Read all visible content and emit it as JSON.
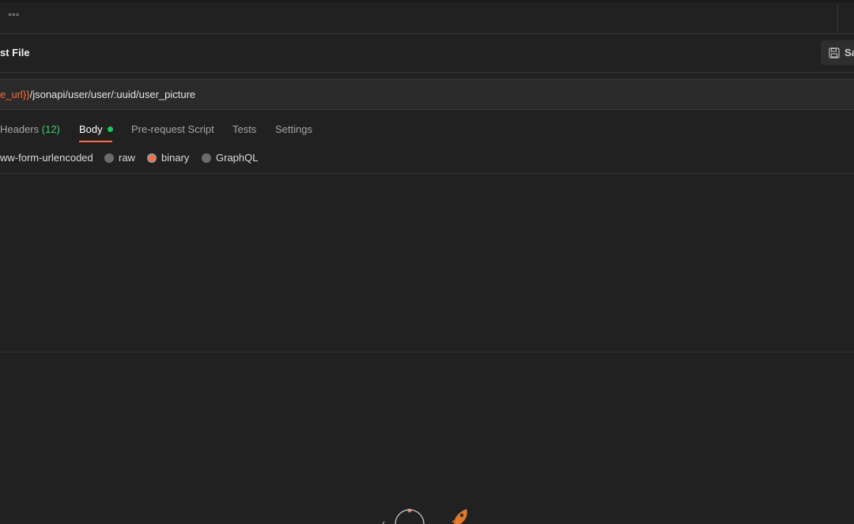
{
  "tabbar": {
    "more_label": "°°°"
  },
  "request": {
    "title": "st File",
    "save_label": "Sa"
  },
  "url": {
    "variable": "e_url}}",
    "path": "/jsonapi/user/user/:uuid/user_picture"
  },
  "request_tabs": [
    {
      "label": "Headers",
      "count": "(12)"
    },
    {
      "label": "Body"
    },
    {
      "label": "Pre-request Script"
    },
    {
      "label": "Tests"
    },
    {
      "label": "Settings"
    }
  ],
  "body_types": [
    {
      "label": "ww-form-urlencoded"
    },
    {
      "label": "raw",
      "selected": false
    },
    {
      "label": "binary",
      "selected": true
    },
    {
      "label": "GraphQL",
      "selected": false
    }
  ],
  "colors": {
    "accent": "#ff6c37",
    "success": "#1ec760",
    "background": "#212121"
  },
  "icons": {
    "more": "ellipsis-icon",
    "save": "save-icon",
    "body_indicator": "green-dot-icon",
    "empty_state": "rocket-illustration"
  }
}
